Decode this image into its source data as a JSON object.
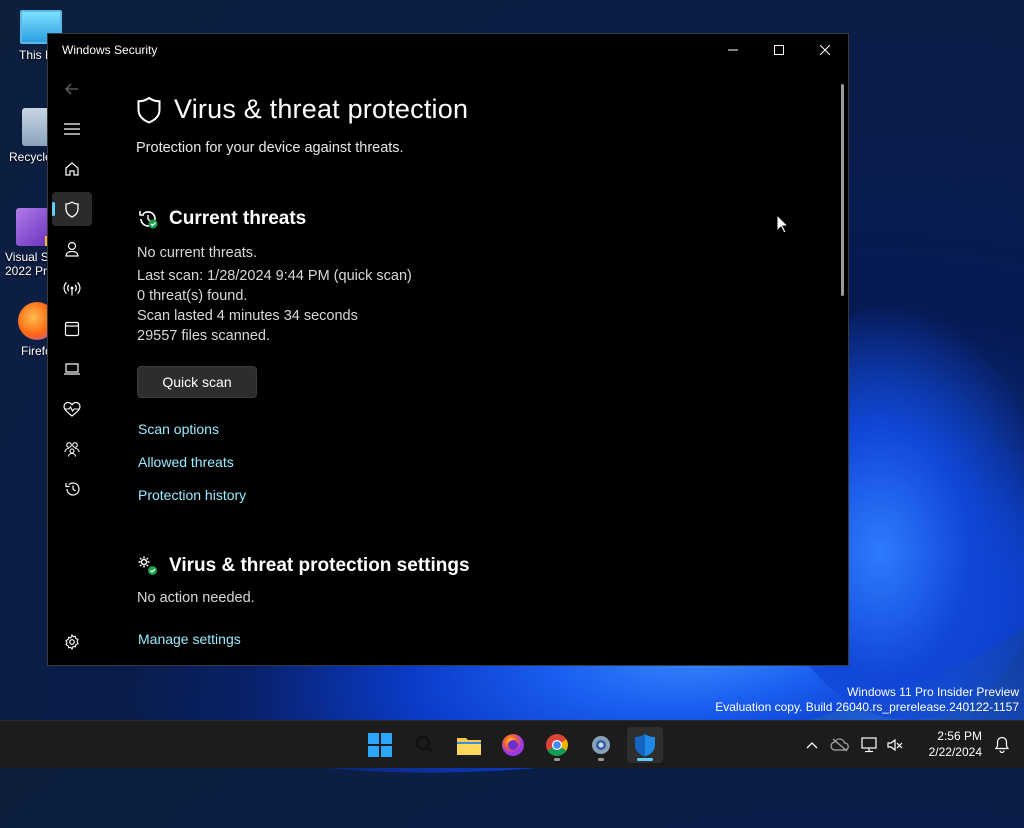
{
  "desktop": {
    "icons": [
      {
        "label": "This P"
      },
      {
        "label": "Recycle"
      },
      {
        "label1": "Visual St",
        "label2": "2022 Pre"
      },
      {
        "label": "Firefo"
      }
    ],
    "watermark": {
      "line1": "Windows 11 Pro Insider Preview",
      "line2": "Evaluation copy. Build 26040.rs_prerelease.240122-1157"
    }
  },
  "window": {
    "title": "Windows Security",
    "controls": {
      "minimize": "minimize",
      "maximize": "maximize",
      "close": "close"
    },
    "nav": [
      {
        "icon": "back-arrow-icon"
      },
      {
        "icon": "hamburger-menu-icon"
      },
      {
        "icon": "home-icon"
      },
      {
        "icon": "shield-icon",
        "active": true
      },
      {
        "icon": "person-icon"
      },
      {
        "icon": "network-antenna-icon"
      },
      {
        "icon": "app-browser-icon"
      },
      {
        "icon": "laptop-icon"
      },
      {
        "icon": "heart-pulse-icon"
      },
      {
        "icon": "family-icon"
      },
      {
        "icon": "history-icon"
      },
      {
        "icon": "settings-gear-icon"
      }
    ]
  },
  "page": {
    "title": "Virus & threat protection",
    "subtitle": "Protection for your device against threats.",
    "current_threats": {
      "heading": "Current threats",
      "lines": [
        "No current threats.",
        "Last scan: 1/28/2024 9:44 PM (quick scan)",
        "0 threat(s) found.",
        "Scan lasted 4 minutes 34 seconds",
        "29557 files scanned."
      ],
      "quick_scan_label": "Quick scan",
      "links": [
        "Scan options",
        "Allowed threats",
        "Protection history"
      ]
    },
    "settings": {
      "heading": "Virus & threat protection settings",
      "status": "No action needed.",
      "link": "Manage settings"
    }
  },
  "taskbar": {
    "apps": [
      "start",
      "search",
      "file-explorer",
      "firefox",
      "chrome",
      "settings",
      "windows-security"
    ],
    "clock": {
      "time": "2:56 PM",
      "date": "2/22/2024"
    }
  }
}
